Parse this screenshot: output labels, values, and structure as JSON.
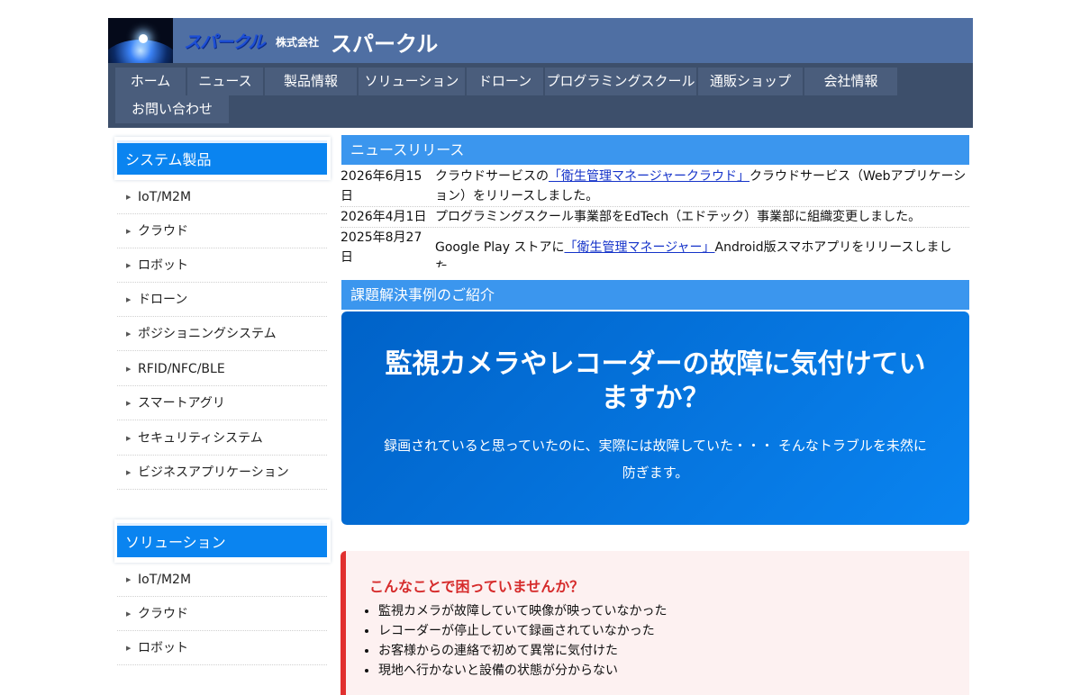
{
  "header": {
    "brand_art": "スパークル",
    "company_prefix": "株式会社",
    "company_name": "スパークル"
  },
  "nav": {
    "items": [
      "ホーム",
      "ニュース",
      "製品情報",
      "ソリューション",
      "ドローン",
      "プログラミングスクール",
      "通販ショップ",
      "会社情報",
      "お問い合わせ"
    ]
  },
  "sidebar": {
    "products_title": "システム製品",
    "products": [
      "IoT/M2M",
      "クラウド",
      "ロボット",
      "ドローン",
      "ポジショニングシステム",
      "RFID/NFC/BLE",
      "スマートアグリ",
      "セキュリティシステム",
      "ビジネスアプリケーション"
    ],
    "solutions_title": "ソリューション",
    "solutions": [
      "IoT/M2M",
      "クラウド",
      "ロボット"
    ]
  },
  "news": {
    "title": "ニュースリリース",
    "items": [
      {
        "date": "2026年6月15日",
        "before": "クラウドサービスの",
        "link": "「衛生管理マネージャークラウド」",
        "after": "クラウドサービス（Webアプリケーション）をリリースしました。"
      },
      {
        "date": "2026年4月1日",
        "before": "プログラミングスクール事業部をEdTech（エドテック）事業部に組織変更しました。",
        "link": "",
        "after": ""
      },
      {
        "date": "2025年8月27日",
        "before": "Google Play ストアに",
        "link": "「衛生管理マネージャー」",
        "after": "Android版スマホアプリをリリースしました。"
      }
    ]
  },
  "cases": {
    "title": "課題解決事例のご紹介",
    "hero_title": "監視カメラやレコーダーの故障に気付けていますか？",
    "hero_sub": "録画されていると思っていたのに、実際には故障していた・・・ そんなトラブルを未然に防ぎます。"
  },
  "trouble": {
    "title": "こんなことで困っていませんか？",
    "items": [
      "監視カメラが故障していて映像が映っていなかった",
      "レコーダーが停止していて録画されていなかった",
      "お客様からの連絡で初めて異常に気付けた",
      "現地へ行かないと設備の状態が分からない"
    ]
  },
  "colors": {
    "header_bg": "#4f6fa3",
    "nav_bg": "#3d4f6b",
    "sidebar_title_bg": "#0a84f0",
    "section_head_bg": "#3b96ee",
    "alert_red": "#e1302f"
  }
}
